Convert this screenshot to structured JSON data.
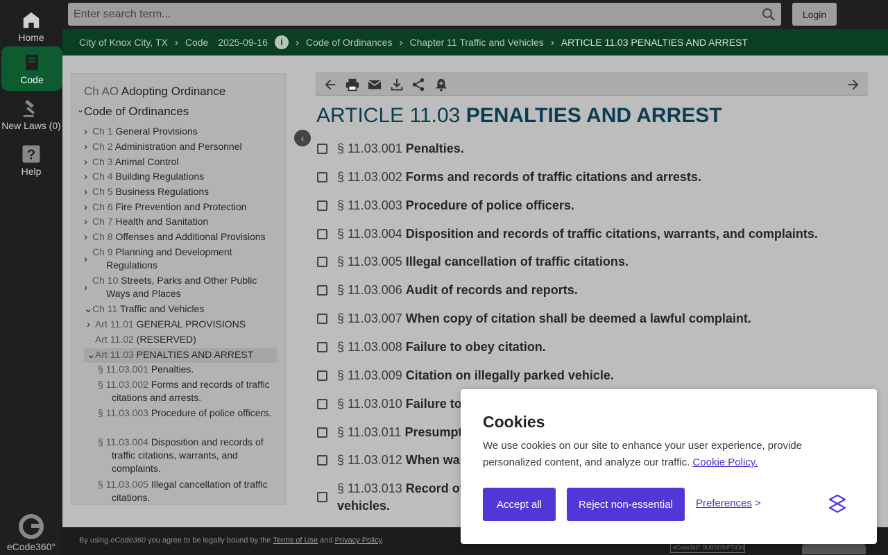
{
  "search": {
    "placeholder": "Enter search term...",
    "login_label": "Login"
  },
  "rail": {
    "items": [
      {
        "label": "Home",
        "icon": "home-icon"
      },
      {
        "label": "Code",
        "icon": "book-icon",
        "active": true
      },
      {
        "label": "New Laws (0)",
        "icon": "gavel-icon"
      },
      {
        "label": "Help",
        "icon": "help-icon"
      }
    ],
    "logo_label": "eCode360°"
  },
  "breadcrumb": {
    "items": [
      "City of Knox City, TX",
      "Code",
      "Code of Ordinances",
      "Chapter 11 Traffic and Vehicles",
      "ARTICLE 11.03 PENALTIES AND ARREST"
    ],
    "code_date": "2025-09-16"
  },
  "toc": {
    "top": [
      {
        "num": "Ch AO",
        "title": "Adopting Ordinance"
      },
      {
        "num": "",
        "title": "Code of Ordinances"
      }
    ],
    "chapters": [
      {
        "num": "Ch 1",
        "title": "General Provisions"
      },
      {
        "num": "Ch 2",
        "title": "Administration and Personnel"
      },
      {
        "num": "Ch 3",
        "title": "Animal Control"
      },
      {
        "num": "Ch 4",
        "title": "Building Regulations"
      },
      {
        "num": "Ch 5",
        "title": "Business Regulations"
      },
      {
        "num": "Ch 6",
        "title": "Fire Prevention and Protection"
      },
      {
        "num": "Ch 7",
        "title": "Health and Sanitation"
      },
      {
        "num": "Ch 8",
        "title": "Offenses and Additional Provisions"
      },
      {
        "num": "Ch 9",
        "title": "Planning and Development Regulations"
      },
      {
        "num": "Ch 10",
        "title": "Streets, Parks and Other Public Ways and Places"
      },
      {
        "num": "Ch 11",
        "title": "Traffic and Vehicles"
      }
    ],
    "articles": [
      {
        "num": "Art 11.01",
        "title": "GENERAL PROVISIONS"
      },
      {
        "num": "Art 11.02",
        "title": "(RESERVED)"
      },
      {
        "num": "Art 11.03",
        "title": "PENALTIES AND ARREST"
      }
    ],
    "sections": [
      {
        "num": "§ 11.03.001",
        "title": "Penalties."
      },
      {
        "num": "§ 11.03.002",
        "title": "Forms and records of traffic citations and arrests."
      },
      {
        "num": "§ 11.03.003",
        "title": "Procedure of police officers."
      },
      {
        "num": "§ 11.03.004",
        "title": "Disposition and records of traffic citations, warrants, and complaints."
      },
      {
        "num": "§ 11.03.005",
        "title": "Illegal cancellation of traffic citations."
      }
    ]
  },
  "article": {
    "num": "ARTICLE 11.03",
    "title": "PENALTIES AND ARREST",
    "sections": [
      {
        "num": "§ 11.03.001",
        "title": "Penalties."
      },
      {
        "num": "§ 11.03.002",
        "title": "Forms and records of traffic citations and arrests."
      },
      {
        "num": "§ 11.03.003",
        "title": "Procedure of police officers."
      },
      {
        "num": "§ 11.03.004",
        "title": "Disposition and records of traffic citations, warrants, and complaints."
      },
      {
        "num": "§ 11.03.005",
        "title": "Illegal cancellation of traffic citations."
      },
      {
        "num": "§ 11.03.006",
        "title": "Audit of records and reports."
      },
      {
        "num": "§ 11.03.007",
        "title": "When copy of citation shall be deemed a lawful complaint."
      },
      {
        "num": "§ 11.03.008",
        "title": "Failure to obey citation."
      },
      {
        "num": "§ 11.03.009",
        "title": "Citation on illegally parked vehicle."
      },
      {
        "num": "§ 11.03.010",
        "title": "Failure to"
      },
      {
        "num": "§ 11.03.011",
        "title": "Presumpt"
      },
      {
        "num": "§ 11.03.012",
        "title": "When wa"
      },
      {
        "num": "§ 11.03.013",
        "title": "Record of"
      }
    ],
    "last_wrap": "vehicles."
  },
  "footer": {
    "prefix": "By using ",
    "brand": "eCode360",
    "middle": " you agree to be legally bound by the ",
    "terms": "Terms of Use",
    "and": " and ",
    "privacy": "Privacy Policy",
    "end": ".",
    "badge": "eCode360° SUBSCRIPTION"
  },
  "cookie": {
    "title": "Cookies",
    "text": "We use cookies on our site to enhance your user experience, provide personalized content, and analyze our traffic.",
    "policy_link": "Cookie Policy.",
    "accept": "Accept all",
    "reject": "Reject non-essential",
    "preferences": "Preferences",
    "pref_arrow": " >"
  }
}
